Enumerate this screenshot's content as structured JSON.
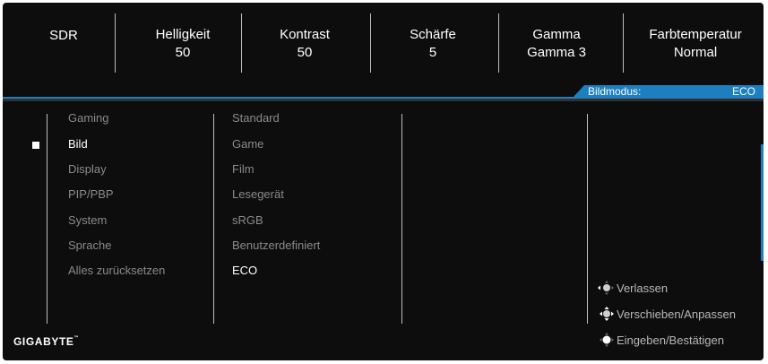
{
  "status_bar": [
    {
      "title": "SDR",
      "value": ""
    },
    {
      "title": "Helligkeit",
      "value": "50"
    },
    {
      "title": "Kontrast",
      "value": "50"
    },
    {
      "title": "Schärfe",
      "value": "5"
    },
    {
      "title": "Gamma",
      "value": "Gamma 3"
    },
    {
      "title": "Farbtemperatur",
      "value": "Normal"
    }
  ],
  "picture_mode": {
    "label": "Bildmodus:",
    "value": "ECO"
  },
  "main_menu": {
    "items": [
      "Gaming",
      "Bild",
      "Display",
      "PIP/PBP",
      "System",
      "Sprache",
      "Alles zurücksetzen"
    ],
    "selected": "Bild"
  },
  "submenu": {
    "items": [
      "Standard",
      "Game",
      "Film",
      "Lesegerät",
      "sRGB",
      "Benutzerdefiniert",
      "ECO"
    ],
    "selected": "ECO"
  },
  "brand": {
    "name": "GIGABYTE",
    "mark": "™"
  },
  "hints": [
    {
      "icon": "joystick-left-icon",
      "label": "Verlassen"
    },
    {
      "icon": "joystick-all-directions-icon",
      "label": "Verschieben/Anpassen"
    },
    {
      "icon": "joystick-press-icon",
      "label": "Eingeben/Bestätigen"
    }
  ],
  "colors": {
    "accent": "#1e7fc0",
    "background": "#0d0d0d",
    "active_text": "#ffffff",
    "inactive_text": "#8a8a8a"
  }
}
